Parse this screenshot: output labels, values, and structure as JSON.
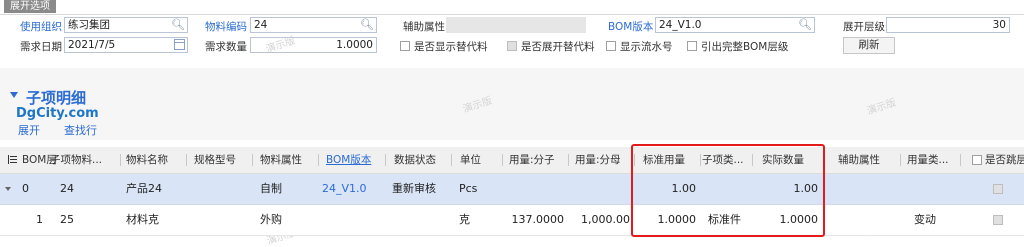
{
  "tab": {
    "label": "展开选项"
  },
  "filters": {
    "org_label": "使用组织",
    "org_value": "练习集团",
    "material_code_label": "物料编码",
    "material_code_value": "24",
    "aux_attr_label": "辅助属性",
    "bom_version_label": "BOM版本",
    "bom_version_value": "24_V1.0",
    "expand_level_label": "展开层级",
    "expand_level_value": "30",
    "demand_date_label": "需求日期",
    "demand_date_value": "2021/7/5",
    "demand_qty_label": "需求数量",
    "demand_qty_value": "1.0000",
    "show_substitute_label": "是否显示替代料",
    "expand_substitute_label": "是否展开替代料",
    "show_serial_label": "显示流水号",
    "full_bom_label": "引出完整BOM层级",
    "refresh_label": "刷新"
  },
  "section": {
    "title": "子项明细",
    "expand_link": "展开",
    "find_row_link": "查找行",
    "site_text": "DgCity.com",
    "watermark": "演示版"
  },
  "grid": {
    "columns": [
      "BOM层",
      "子项物料...",
      "物料名称",
      "规格型号",
      "物料属性",
      "BOM版本",
      "数据状态",
      "单位",
      "用量:分子",
      "用量:分母",
      "标准用量",
      "子项类...",
      "实际数量",
      "辅助属性",
      "用量类...",
      "是否跳层"
    ],
    "rows": [
      {
        "level": "0",
        "code": "24",
        "name": "产品24",
        "spec": "",
        "attr": "自制",
        "bom": "24_V1.0",
        "status": "重新审核",
        "unit": "Pcs",
        "num": "",
        "den": "",
        "std_qty": "1.00",
        "type": "",
        "actual_qty": "1.00",
        "aux": "",
        "usage_type": ""
      },
      {
        "level": "1",
        "code": "25",
        "name": "材料克",
        "spec": "",
        "attr": "外购",
        "bom": "",
        "status": "",
        "unit": "克",
        "num": "137.0000",
        "den": "1,000.00",
        "std_qty": "1.0000",
        "type": "标准件",
        "actual_qty": "1.0000",
        "aux": "",
        "usage_type": "变动"
      }
    ]
  },
  "colors": {
    "accent": "#2b6cd4",
    "selected_row": "#d9e4f6",
    "highlight_box": "#e41b1b"
  }
}
